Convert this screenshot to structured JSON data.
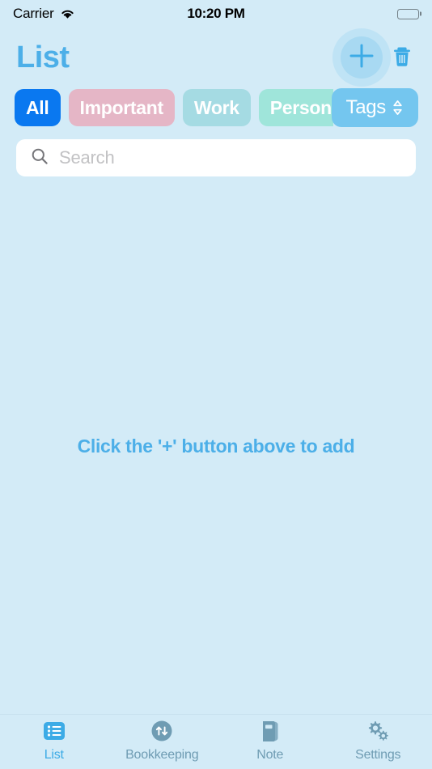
{
  "status_bar": {
    "carrier": "Carrier",
    "time": "10:20 PM",
    "wifi_icon": "wifi-icon",
    "battery_icon": "battery-full-icon"
  },
  "header": {
    "title": "List",
    "add_icon": "plus-icon",
    "delete_icon": "trash-icon"
  },
  "filters": {
    "chips": [
      {
        "label": "All",
        "bg": "#0a78f0",
        "active": true,
        "clipped": false
      },
      {
        "label": "Important",
        "bg": "#e5b6c6",
        "active": false,
        "clipped": false
      },
      {
        "label": "Work",
        "bg": "#a5dbe3",
        "active": false,
        "clipped": false
      },
      {
        "label": "Personal",
        "bg": "#9fe5da",
        "active": false,
        "clipped": true
      }
    ],
    "tags_label": "Tags",
    "tags_icon": "chevron-up-down-icon",
    "tags_bg": "#74c6ef"
  },
  "search": {
    "placeholder": "Search",
    "value": "",
    "icon": "search-icon"
  },
  "content": {
    "empty_message": "Click the '+' button above to add"
  },
  "tab_bar": {
    "items": [
      {
        "label": "List",
        "icon": "list-icon",
        "active": true
      },
      {
        "label": "Bookkeeping",
        "icon": "transfer-icon",
        "active": false
      },
      {
        "label": "Note",
        "icon": "book-icon",
        "active": false
      },
      {
        "label": "Settings",
        "icon": "gears-icon",
        "active": false
      }
    ]
  },
  "colors": {
    "background": "#d3ebf7",
    "accent": "#4cafe8",
    "accent_strong": "#0a78f0",
    "tab_inactive": "#6f9cb3",
    "card_bg": "#ffffff"
  }
}
